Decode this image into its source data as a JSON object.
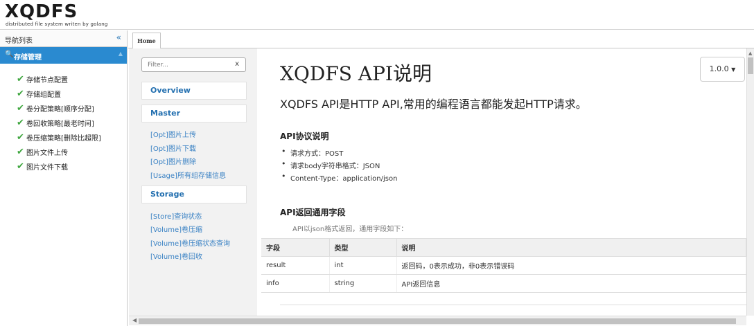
{
  "header": {
    "logo": "XQDFS",
    "tagline": "distributed file system writen by golang"
  },
  "sidebar": {
    "title": "导航列表",
    "collapse_icon": "«",
    "group": {
      "label": "存储管理"
    },
    "items": [
      {
        "label": "存储节点配置"
      },
      {
        "label": "存储组配置"
      },
      {
        "label": "卷分配策略[顺序分配]"
      },
      {
        "label": "卷回收策略[最老时间]"
      },
      {
        "label": "卷压缩策略[删除比超限]"
      },
      {
        "label": "图片文件上传"
      },
      {
        "label": "图片文件下载"
      }
    ]
  },
  "tabs": [
    {
      "label": "Home"
    }
  ],
  "docnav": {
    "filter_placeholder": "Filter...",
    "filter_clear": "x",
    "overview": "Overview",
    "master": {
      "label": "Master",
      "links": [
        "[Opt]图片上传",
        "[Opt]图片下载",
        "[Opt]图片删除",
        "[Usage]所有组存储信息"
      ]
    },
    "storage": {
      "label": "Storage",
      "links": [
        "[Store]查询状态",
        "[Volume]卷压缩",
        "[Volume]卷压缩状态查询",
        "[Volume]卷回收"
      ]
    }
  },
  "doc": {
    "title": "XQDFS API说明",
    "version": "1.0.0",
    "lead": "XQDFS API是HTTP API,常用的编程语言都能发起HTTP请求。",
    "protocol": {
      "heading": "API协议说明",
      "items": [
        "请求方式：POST",
        "请求body字符串格式：JSON",
        "Content-Type：application/json"
      ]
    },
    "returns": {
      "heading": "API返回通用字段",
      "desc": "API以json格式返回，通用字段如下：",
      "columns": [
        "字段",
        "类型",
        "说明"
      ],
      "rows": [
        [
          "result",
          "int",
          "返回码，0表示成功，非0表示错误码"
        ],
        [
          "info",
          "string",
          "API返回信息"
        ]
      ]
    }
  }
}
